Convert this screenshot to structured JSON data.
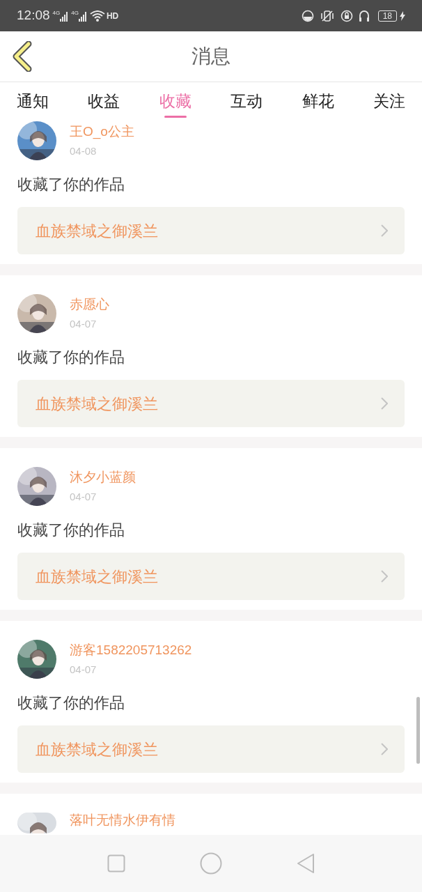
{
  "status_bar": {
    "time": "12:08",
    "sim_labels": [
      "4G",
      "4G"
    ],
    "hd_label": "HD",
    "battery": "18"
  },
  "header": {
    "title": "消息"
  },
  "tabs": [
    {
      "label": "通知",
      "selected": false
    },
    {
      "label": "收益",
      "selected": false
    },
    {
      "label": "收藏",
      "selected": true
    },
    {
      "label": "互动",
      "selected": false
    },
    {
      "label": "鲜花",
      "selected": false
    },
    {
      "label": "关注",
      "selected": false
    }
  ],
  "messages": [
    {
      "name": "王O_o公主",
      "date": "04-08",
      "text": "收藏了你的作品",
      "work": "血族禁域之御溪兰"
    },
    {
      "name": "赤愿心",
      "date": "04-07",
      "text": "收藏了你的作品",
      "work": "血族禁域之御溪兰"
    },
    {
      "name": "沐夕小蓝颜",
      "date": "04-07",
      "text": "收藏了你的作品",
      "work": "血族禁域之御溪兰"
    },
    {
      "name": "游客1582205713262",
      "date": "04-07",
      "text": "收藏了你的作品",
      "work": "血族禁域之御溪兰"
    },
    {
      "name": "落叶无情水伊有情"
    }
  ]
}
